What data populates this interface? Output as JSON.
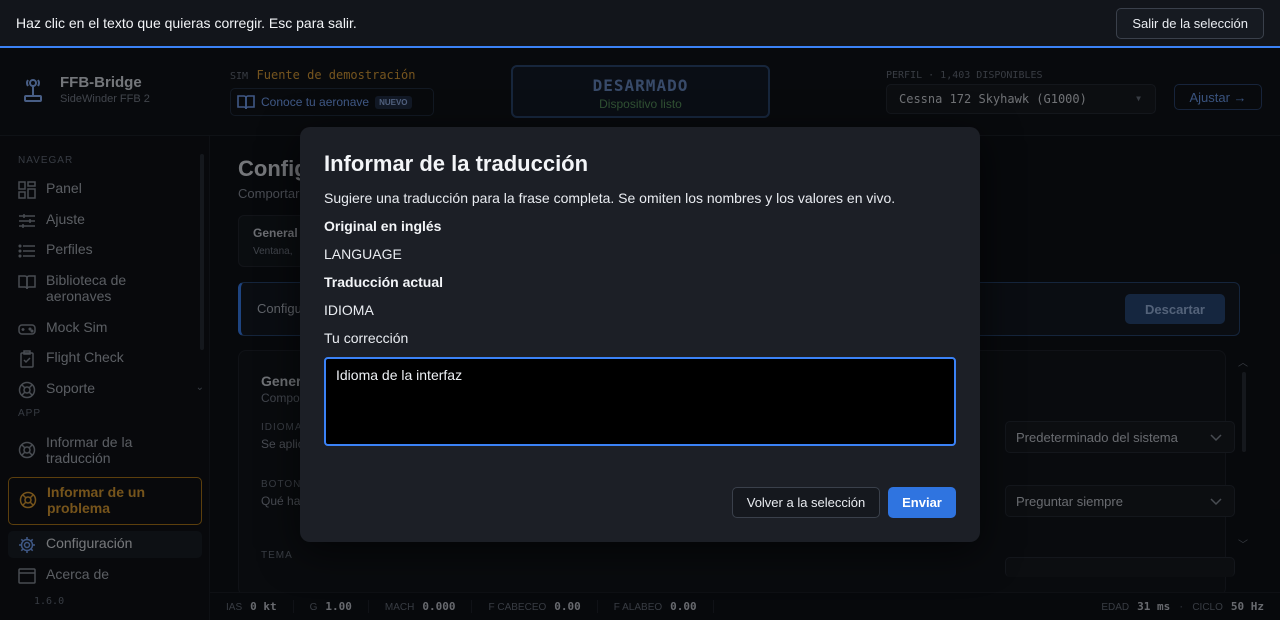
{
  "topbar": {
    "instruction": "Haz clic en el texto que quieras corregir. Esc para salir.",
    "exit_label": "Salir de la selección"
  },
  "app": {
    "name": "FFB-Bridge",
    "subtitle": "SideWinder FFB 2",
    "sim_label": "SIM",
    "sim_value": "Fuente de demostración",
    "aircraft_link": "Conoce tu aeronave",
    "aircraft_badge": "NUEVO",
    "armed_title": "DESARMADO",
    "armed_sub": "Dispositivo listo",
    "profile_label": "PERFIL · 1,403 DISPONIBLES",
    "profile_value": "Cessna 172 Skyhawk (G1000)",
    "adjust_label": "Ajustar"
  },
  "sidebar": {
    "section_nav": "NAVEGAR",
    "section_app": "APP",
    "items": [
      {
        "label": "Panel"
      },
      {
        "label": "Ajuste"
      },
      {
        "label": "Perfiles"
      },
      {
        "label": "Biblioteca de aeronaves"
      },
      {
        "label": "Mock Sim"
      },
      {
        "label": "Flight Check"
      },
      {
        "label": "Soporte"
      }
    ],
    "app_items": [
      {
        "label": "Informar de la traducción"
      },
      {
        "label": "Informar de un problema"
      },
      {
        "label": "Configuración"
      },
      {
        "label": "Acerca de"
      }
    ],
    "version": "1.6.0"
  },
  "main": {
    "title": "Config",
    "subtitle": "Comportar",
    "tab_title": "General",
    "tab_sub": "Ventana,",
    "notice_text": "Configu",
    "discard_label": "Descartar",
    "card_title": "Gener",
    "card_sub": "Compo",
    "rows": [
      {
        "label": "IDIOMA",
        "desc": "Se aplic",
        "value": "Predeterminado del sistema"
      },
      {
        "label": "BOTON",
        "desc": "Qué hac",
        "value": "Preguntar siempre"
      },
      {
        "label": "TEMA",
        "desc": "",
        "value": ""
      }
    ]
  },
  "statusbar": {
    "items": [
      {
        "k": "IAS",
        "v": "0 kt"
      },
      {
        "k": "G",
        "v": "1.00"
      },
      {
        "k": "MACH",
        "v": "0.000"
      },
      {
        "k": "F CABECEO",
        "v": "0.00"
      },
      {
        "k": "F ALABEO",
        "v": "0.00"
      }
    ],
    "edad_k": "EDAD",
    "edad_v": "31 ms",
    "ciclo_k": "CICLO",
    "ciclo_v": "50 Hz"
  },
  "modal": {
    "title": "Informar de la traducción",
    "description": "Sugiere una traducción para la frase completa. Se omiten los nombres y los valores en vivo.",
    "original_label": "Original en inglés",
    "original_value": "LANGUAGE",
    "current_label": "Traducción actual",
    "current_value": "IDIOMA",
    "correction_label": "Tu corrección",
    "correction_value": "Idioma de la interfaz",
    "back_label": "Volver a la selección",
    "send_label": "Enviar"
  }
}
